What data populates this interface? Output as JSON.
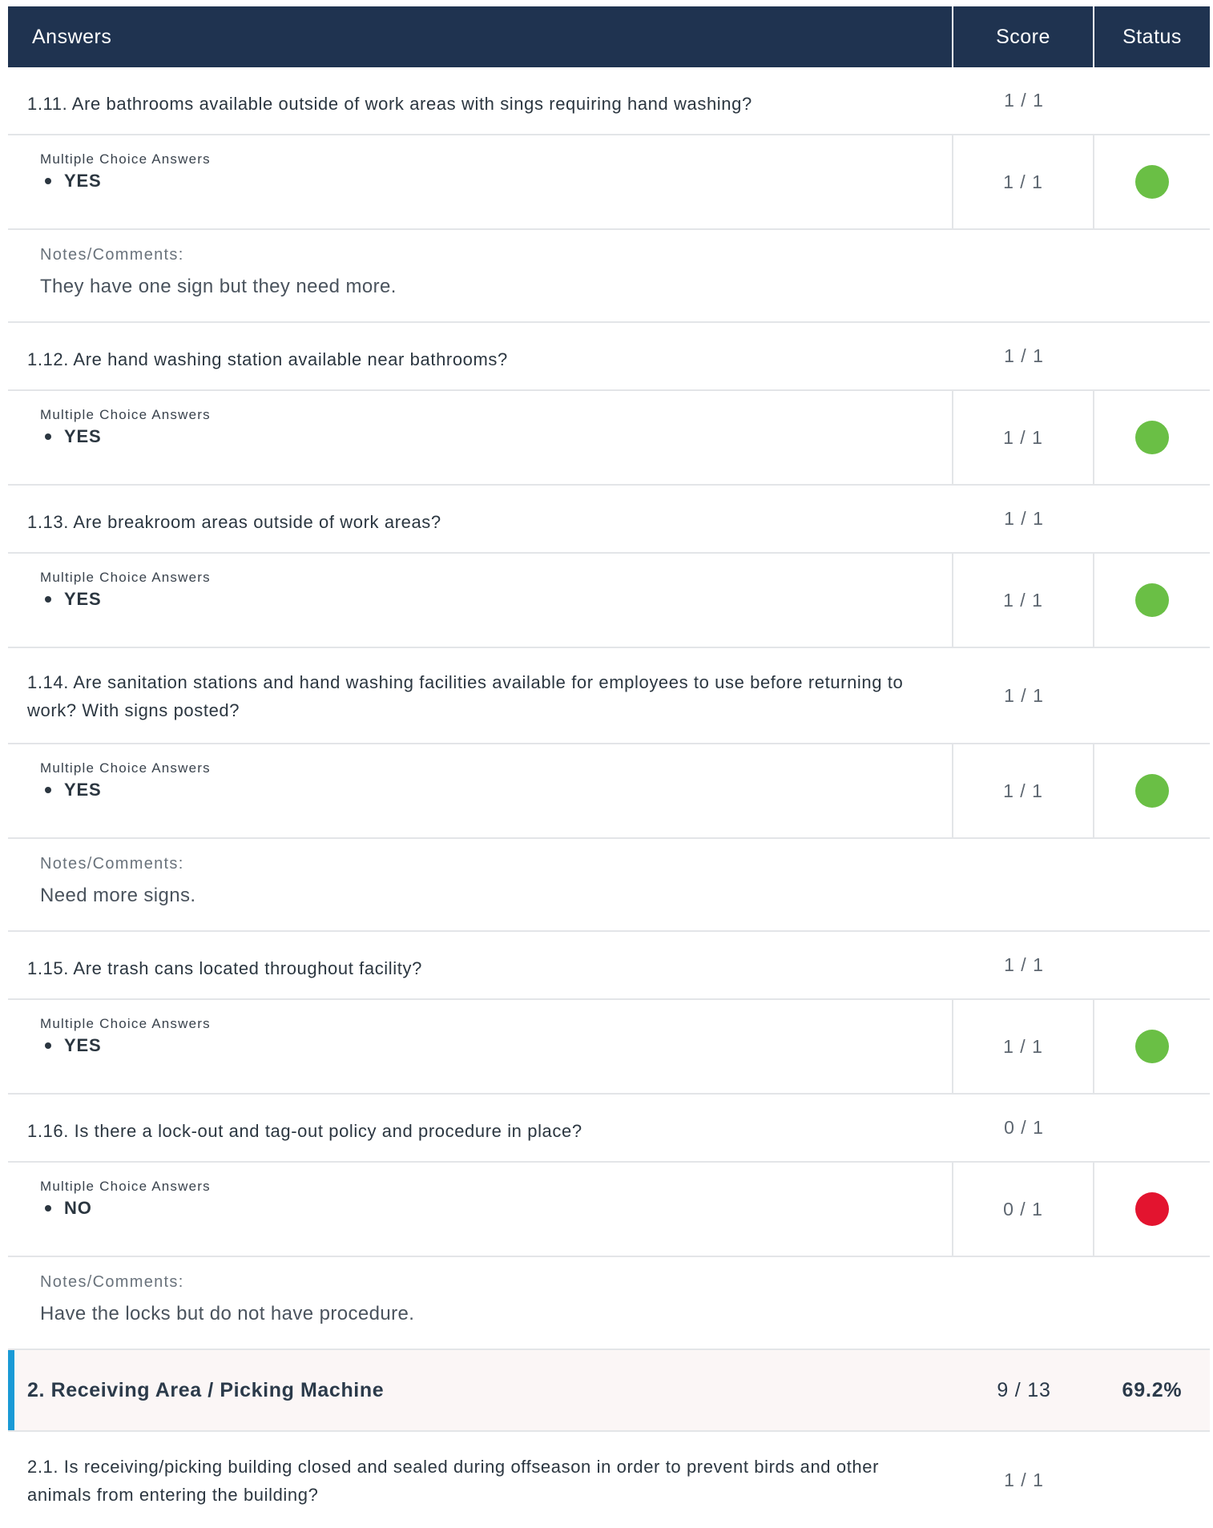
{
  "header": {
    "answers": "Answers",
    "score": "Score",
    "status": "Status"
  },
  "items": [
    {
      "question": "1.11. Are bathrooms available outside of work areas with sings requiring hand washing?",
      "score": "1 / 1",
      "answer_label": "Multiple Choice Answers",
      "answer": "YES",
      "answer_score": "1 / 1",
      "status_color": "#6abf45",
      "notes_label": "Notes/Comments:",
      "notes": "They have one sign but they need more."
    },
    {
      "question": "1.12. Are hand washing station available near bathrooms?",
      "score": "1 / 1",
      "answer_label": "Multiple Choice Answers",
      "answer": "YES",
      "answer_score": "1 / 1",
      "status_color": "#6abf45"
    },
    {
      "question": "1.13. Are breakroom areas outside of work areas?",
      "score": "1 / 1",
      "answer_label": "Multiple Choice Answers",
      "answer": "YES",
      "answer_score": "1 / 1",
      "status_color": "#6abf45"
    },
    {
      "question": "1.14. Are sanitation stations and hand washing facilities available for employees to use before returning to work? With signs posted?",
      "score": "1 / 1",
      "answer_label": "Multiple Choice Answers",
      "answer": "YES",
      "answer_score": "1 / 1",
      "status_color": "#6abf45",
      "notes_label": "Notes/Comments:",
      "notes": "Need more signs."
    },
    {
      "question": "1.15. Are trash cans located throughout facility?",
      "score": "1 / 1",
      "answer_label": "Multiple Choice Answers",
      "answer": "YES",
      "answer_score": "1 / 1",
      "status_color": "#6abf45"
    },
    {
      "question": "1.16. Is there a lock-out and tag-out policy and procedure in place?",
      "score": "0 / 1",
      "answer_label": "Multiple Choice Answers",
      "answer": "NO",
      "answer_score": "0 / 1",
      "status_color": "#e3142f",
      "notes_label": "Notes/Comments:",
      "notes": "Have the locks but do not have procedure."
    }
  ],
  "section": {
    "title": "2. Receiving Area / Picking Machine",
    "score": "9 / 13",
    "percent": "69.2%",
    "accent_color": "#1a9ad6"
  },
  "next_question": {
    "question": "2.1. Is receiving/picking building closed and sealed during offseason in order to prevent birds and other animals from entering the building?",
    "score": "1 / 1"
  }
}
